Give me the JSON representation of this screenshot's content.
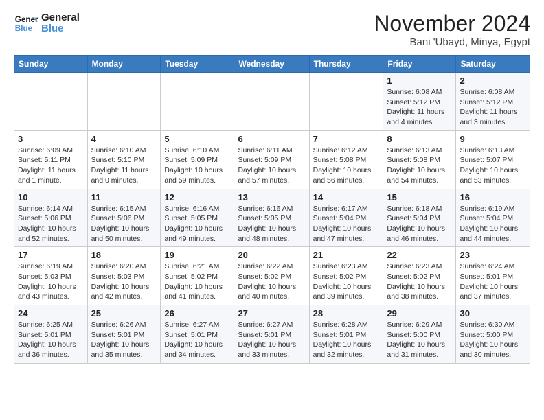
{
  "header": {
    "logo_line1": "General",
    "logo_line2": "Blue",
    "month": "November 2024",
    "location": "Bani 'Ubayd, Minya, Egypt"
  },
  "weekdays": [
    "Sunday",
    "Monday",
    "Tuesday",
    "Wednesday",
    "Thursday",
    "Friday",
    "Saturday"
  ],
  "weeks": [
    [
      {
        "day": "",
        "info": ""
      },
      {
        "day": "",
        "info": ""
      },
      {
        "day": "",
        "info": ""
      },
      {
        "day": "",
        "info": ""
      },
      {
        "day": "",
        "info": ""
      },
      {
        "day": "1",
        "info": "Sunrise: 6:08 AM\nSunset: 5:12 PM\nDaylight: 11 hours\nand 4 minutes."
      },
      {
        "day": "2",
        "info": "Sunrise: 6:08 AM\nSunset: 5:12 PM\nDaylight: 11 hours\nand 3 minutes."
      }
    ],
    [
      {
        "day": "3",
        "info": "Sunrise: 6:09 AM\nSunset: 5:11 PM\nDaylight: 11 hours\nand 1 minute."
      },
      {
        "day": "4",
        "info": "Sunrise: 6:10 AM\nSunset: 5:10 PM\nDaylight: 11 hours\nand 0 minutes."
      },
      {
        "day": "5",
        "info": "Sunrise: 6:10 AM\nSunset: 5:09 PM\nDaylight: 10 hours\nand 59 minutes."
      },
      {
        "day": "6",
        "info": "Sunrise: 6:11 AM\nSunset: 5:09 PM\nDaylight: 10 hours\nand 57 minutes."
      },
      {
        "day": "7",
        "info": "Sunrise: 6:12 AM\nSunset: 5:08 PM\nDaylight: 10 hours\nand 56 minutes."
      },
      {
        "day": "8",
        "info": "Sunrise: 6:13 AM\nSunset: 5:08 PM\nDaylight: 10 hours\nand 54 minutes."
      },
      {
        "day": "9",
        "info": "Sunrise: 6:13 AM\nSunset: 5:07 PM\nDaylight: 10 hours\nand 53 minutes."
      }
    ],
    [
      {
        "day": "10",
        "info": "Sunrise: 6:14 AM\nSunset: 5:06 PM\nDaylight: 10 hours\nand 52 minutes."
      },
      {
        "day": "11",
        "info": "Sunrise: 6:15 AM\nSunset: 5:06 PM\nDaylight: 10 hours\nand 50 minutes."
      },
      {
        "day": "12",
        "info": "Sunrise: 6:16 AM\nSunset: 5:05 PM\nDaylight: 10 hours\nand 49 minutes."
      },
      {
        "day": "13",
        "info": "Sunrise: 6:16 AM\nSunset: 5:05 PM\nDaylight: 10 hours\nand 48 minutes."
      },
      {
        "day": "14",
        "info": "Sunrise: 6:17 AM\nSunset: 5:04 PM\nDaylight: 10 hours\nand 47 minutes."
      },
      {
        "day": "15",
        "info": "Sunrise: 6:18 AM\nSunset: 5:04 PM\nDaylight: 10 hours\nand 46 minutes."
      },
      {
        "day": "16",
        "info": "Sunrise: 6:19 AM\nSunset: 5:04 PM\nDaylight: 10 hours\nand 44 minutes."
      }
    ],
    [
      {
        "day": "17",
        "info": "Sunrise: 6:19 AM\nSunset: 5:03 PM\nDaylight: 10 hours\nand 43 minutes."
      },
      {
        "day": "18",
        "info": "Sunrise: 6:20 AM\nSunset: 5:03 PM\nDaylight: 10 hours\nand 42 minutes."
      },
      {
        "day": "19",
        "info": "Sunrise: 6:21 AM\nSunset: 5:02 PM\nDaylight: 10 hours\nand 41 minutes."
      },
      {
        "day": "20",
        "info": "Sunrise: 6:22 AM\nSunset: 5:02 PM\nDaylight: 10 hours\nand 40 minutes."
      },
      {
        "day": "21",
        "info": "Sunrise: 6:23 AM\nSunset: 5:02 PM\nDaylight: 10 hours\nand 39 minutes."
      },
      {
        "day": "22",
        "info": "Sunrise: 6:23 AM\nSunset: 5:02 PM\nDaylight: 10 hours\nand 38 minutes."
      },
      {
        "day": "23",
        "info": "Sunrise: 6:24 AM\nSunset: 5:01 PM\nDaylight: 10 hours\nand 37 minutes."
      }
    ],
    [
      {
        "day": "24",
        "info": "Sunrise: 6:25 AM\nSunset: 5:01 PM\nDaylight: 10 hours\nand 36 minutes."
      },
      {
        "day": "25",
        "info": "Sunrise: 6:26 AM\nSunset: 5:01 PM\nDaylight: 10 hours\nand 35 minutes."
      },
      {
        "day": "26",
        "info": "Sunrise: 6:27 AM\nSunset: 5:01 PM\nDaylight: 10 hours\nand 34 minutes."
      },
      {
        "day": "27",
        "info": "Sunrise: 6:27 AM\nSunset: 5:01 PM\nDaylight: 10 hours\nand 33 minutes."
      },
      {
        "day": "28",
        "info": "Sunrise: 6:28 AM\nSunset: 5:01 PM\nDaylight: 10 hours\nand 32 minutes."
      },
      {
        "day": "29",
        "info": "Sunrise: 6:29 AM\nSunset: 5:00 PM\nDaylight: 10 hours\nand 31 minutes."
      },
      {
        "day": "30",
        "info": "Sunrise: 6:30 AM\nSunset: 5:00 PM\nDaylight: 10 hours\nand 30 minutes."
      }
    ]
  ]
}
